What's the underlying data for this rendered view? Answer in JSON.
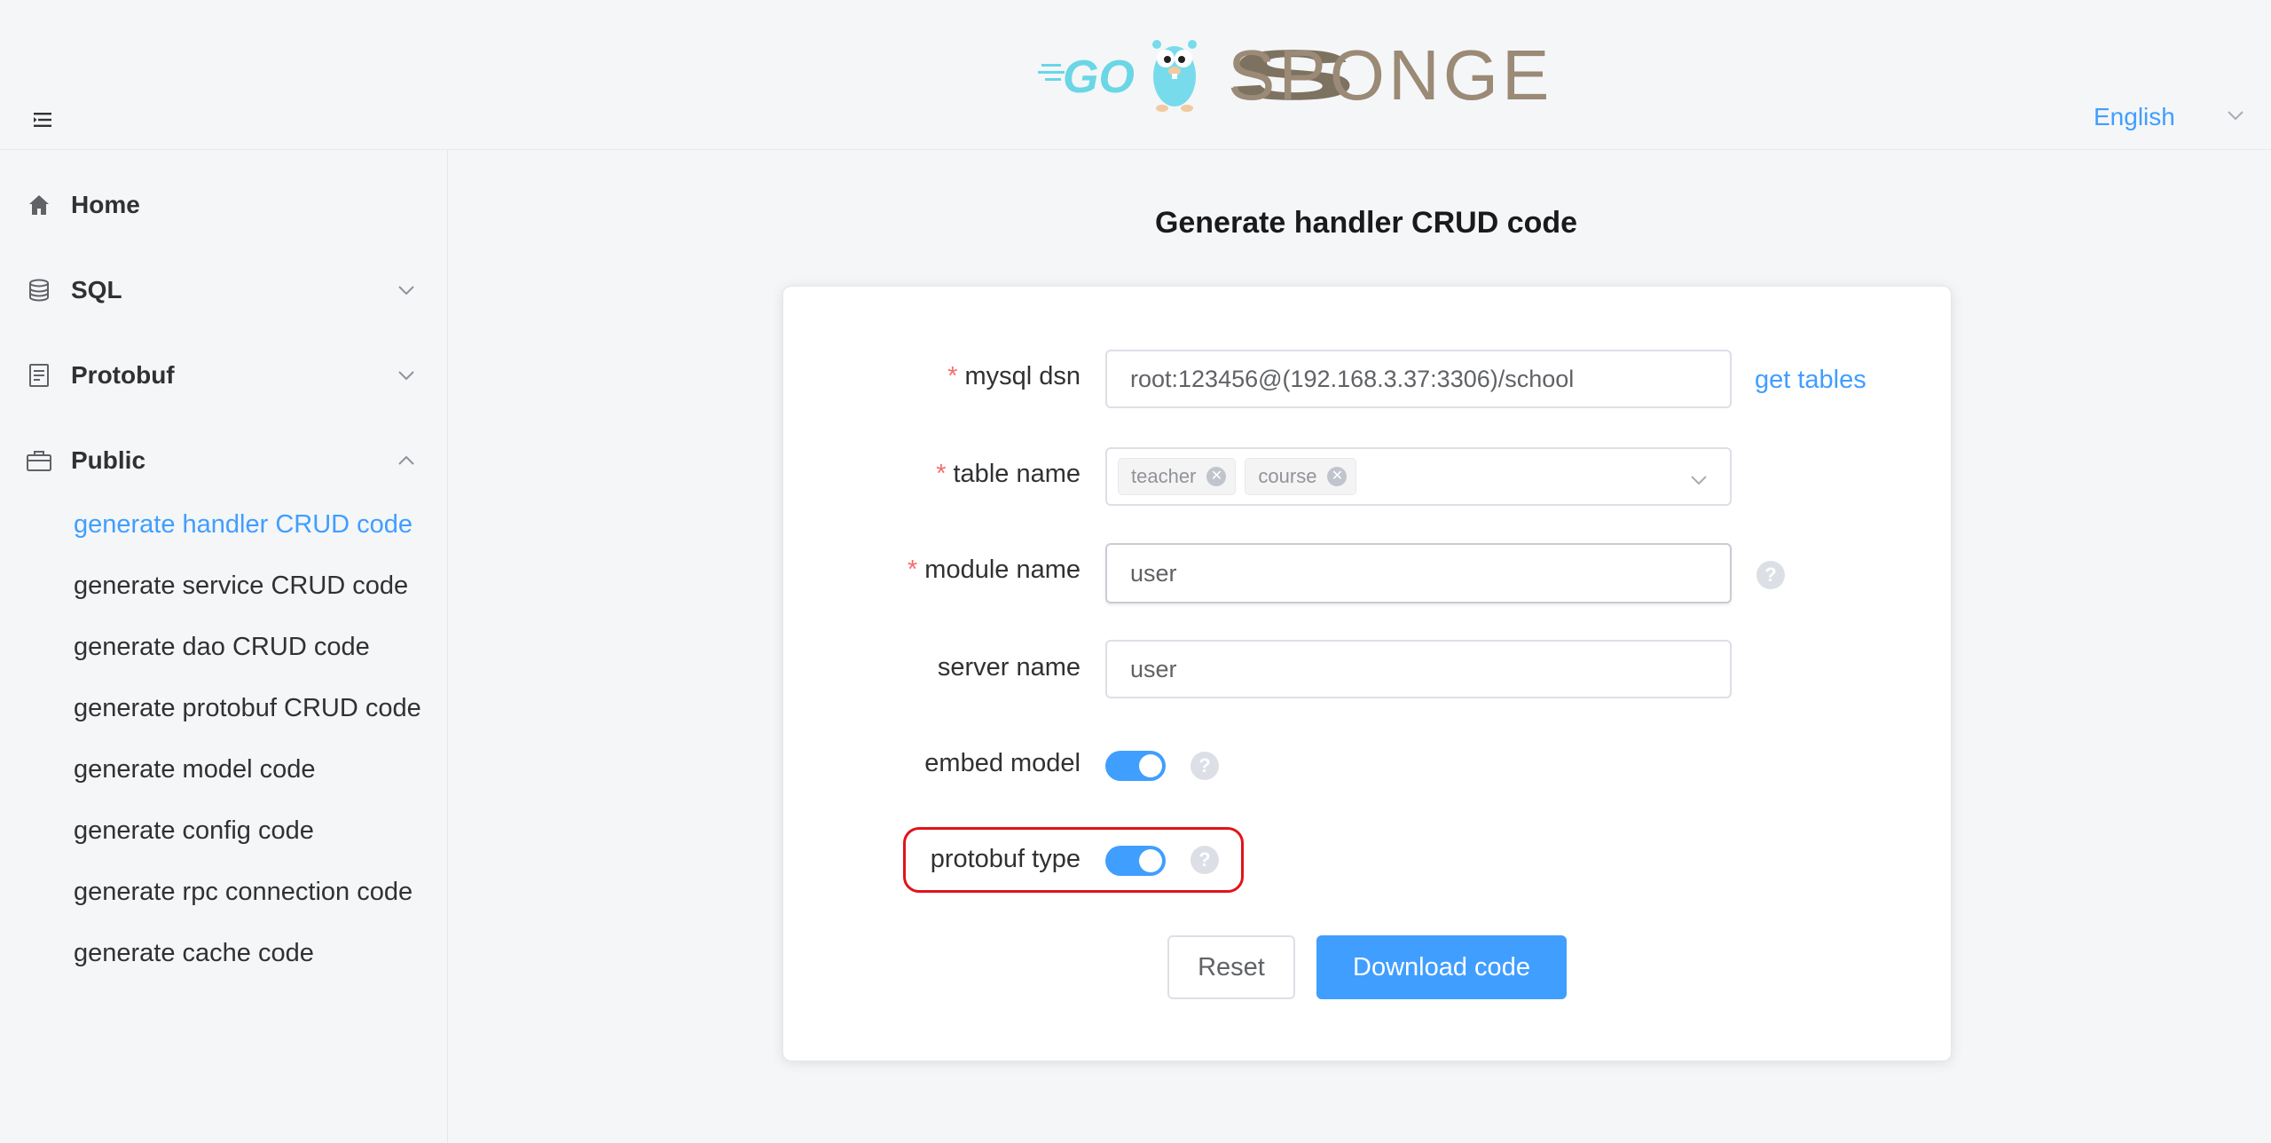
{
  "header": {
    "menu_toggle_icon": "menu-fold-icon",
    "logo_text_left": "GO",
    "logo_text_right": "SPONGE",
    "language": "English"
  },
  "sidebar": {
    "items": [
      {
        "label": "Home",
        "icon": "home-icon"
      },
      {
        "label": "SQL",
        "icon": "database-icon",
        "arrow": "chevron-down"
      },
      {
        "label": "Protobuf",
        "icon": "document-icon",
        "arrow": "chevron-down"
      },
      {
        "label": "Public",
        "icon": "briefcase-icon",
        "arrow": "chevron-up"
      }
    ],
    "public_sub_items": [
      "generate handler CRUD code",
      "generate service CRUD code",
      "generate dao CRUD code",
      "generate protobuf CRUD code",
      "generate model code",
      "generate config code",
      "generate rpc connection code",
      "generate cache code"
    ],
    "active_sub_item": "generate handler CRUD code"
  },
  "main": {
    "title": "Generate handler CRUD code",
    "form": {
      "mysql_dsn": {
        "label": "mysql dsn",
        "required": "*",
        "value": "root:123456@(192.168.3.37:3306)/school",
        "link": "get tables"
      },
      "table_name": {
        "label": "table name",
        "required": "*",
        "tags": [
          "teacher",
          "course"
        ]
      },
      "module_name": {
        "label": "module name",
        "required": "*",
        "value": "user"
      },
      "server_name": {
        "label": "server name",
        "value": "user"
      },
      "embed_model": {
        "label": "embed model",
        "enabled": true
      },
      "protobuf_type": {
        "label": "protobuf type",
        "enabled": true
      },
      "help_symbol": "?"
    },
    "buttons": {
      "reset": "Reset",
      "download": "Download code"
    }
  },
  "colors": {
    "accent": "#409eff",
    "required": "#f56c6c",
    "highlight": "#e0141a"
  }
}
